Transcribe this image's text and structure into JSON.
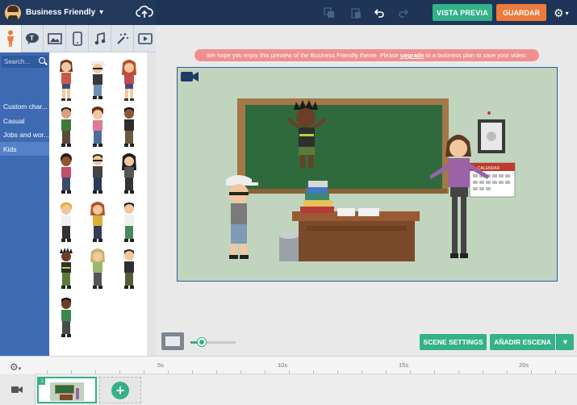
{
  "header": {
    "theme_name": "Business Friendly",
    "preview_label": "VISTA PREVIA",
    "save_label": "GUARDAR"
  },
  "left_panel": {
    "search_placeholder": "Search...",
    "categories": [
      {
        "label": "Custom char..."
      },
      {
        "label": "Casual"
      },
      {
        "label": "Jobs and wor..."
      },
      {
        "label": "Kids"
      }
    ],
    "active_category": "Kids"
  },
  "banner": {
    "prefix": "We hope you enjoy this preview of the Business Friendly theme. Please ",
    "link": "upgrade",
    "suffix": " to a business plan to save your video."
  },
  "stage": {
    "calendar_label": "CALENDAR"
  },
  "controls": {
    "zoom_level": 0.25,
    "scene_settings_label": "SCENE SETTINGS",
    "add_scene_label": "AÑADIR ESCENA"
  },
  "timeline": {
    "ticks": [
      "5s",
      "10s",
      "15s",
      "20s"
    ],
    "scene_number": "1",
    "add_label": "+"
  },
  "colors": {
    "accent_green": "#35b18a",
    "save_orange": "#ee7a3b",
    "nav_blue": "#3d6ab2",
    "top_bar": "#1e3558",
    "banner_pink": "#f08f8f"
  }
}
